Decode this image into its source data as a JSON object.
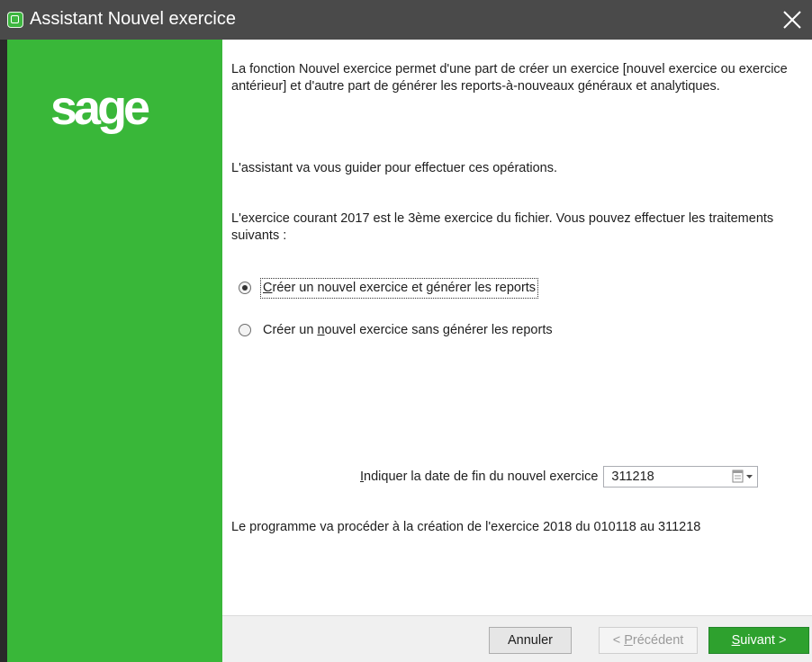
{
  "window": {
    "title": "Assistant Nouvel exercice",
    "close_glyph": "✕"
  },
  "sidebar": {
    "logo_text": "sage",
    "color": "#39b739"
  },
  "content": {
    "intro": "La fonction Nouvel exercice permet d'une part de créer un exercice [nouvel exercice ou exercice antérieur] et d'autre part de générer les reports-à-nouveaux généraux et analytiques.",
    "guide": "L'assistant va vous guider pour effectuer ces opérations.",
    "current_year": "L'exercice courant 2017 est le 3ème exercice du fichier. Vous pouvez effectuer les traitements suivants :",
    "options": [
      {
        "pre": "",
        "mnemonic": "C",
        "post": "réer un nouvel exercice et générer les reports",
        "selected": true
      },
      {
        "pre": "Créer un ",
        "mnemonic": "n",
        "post": "ouvel exercice sans générer les reports",
        "selected": false
      }
    ],
    "date": {
      "label_mnemonic": "I",
      "label_rest": "ndiquer la date de fin du nouvel exercice",
      "value": "311218"
    },
    "summary": "Le programme va procéder à la création de l'exercice 2018 du 010118 au 311218"
  },
  "footer": {
    "cancel": "Annuler",
    "prev_pre": "< ",
    "prev_mnemonic": "P",
    "prev_rest": "récédent",
    "next_mnemonic": "S",
    "next_rest": "uivant >",
    "accent": "#2ea12e"
  }
}
